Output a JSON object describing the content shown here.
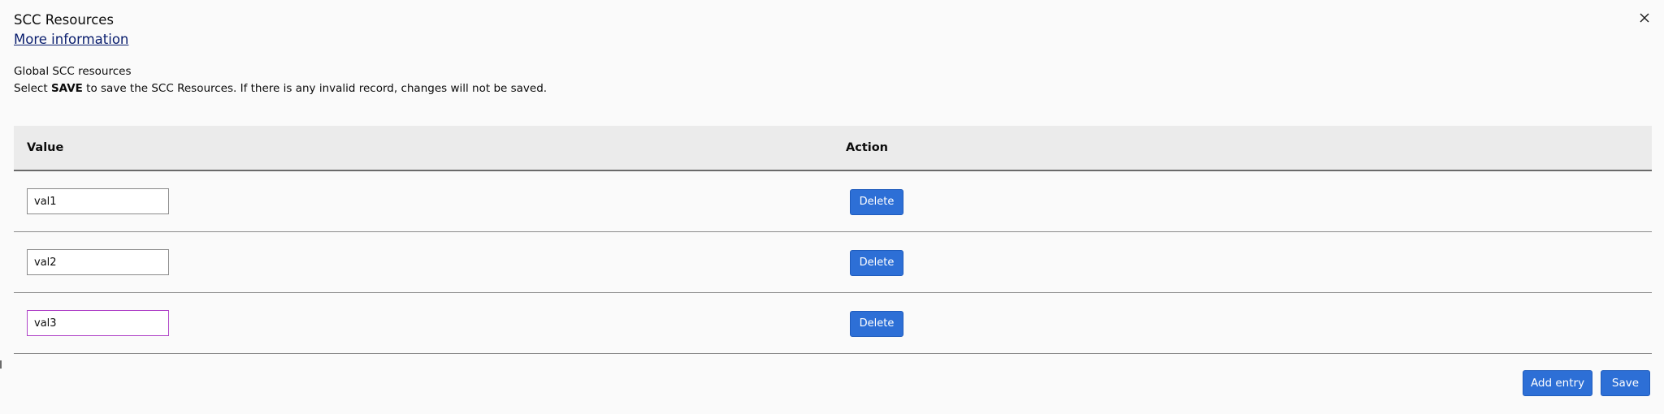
{
  "dialog": {
    "title": "SCC Resources",
    "more_info_label": "More information",
    "description_line1": "Global SCC resources",
    "description_line2_prefix": "Select ",
    "description_line2_bold": "SAVE",
    "description_line2_suffix": " to save the SCC Resources. If there is any invalid record, changes will not be saved.",
    "close_icon": "close-icon"
  },
  "table": {
    "columns": [
      "Value",
      "Action"
    ],
    "rows": [
      {
        "value": "val1",
        "action_label": "Delete",
        "focused": false
      },
      {
        "value": "val2",
        "action_label": "Delete",
        "focused": false
      },
      {
        "value": "val3",
        "action_label": "Delete",
        "focused": true
      }
    ]
  },
  "footer": {
    "add_entry_label": "Add entry",
    "save_label": "Save"
  },
  "colors": {
    "primary_button": "#2d6fd6",
    "link": "#0a1e6e",
    "focus_border": "#b044c8",
    "header_background": "#ebebeb",
    "page_background": "#fafafa"
  }
}
